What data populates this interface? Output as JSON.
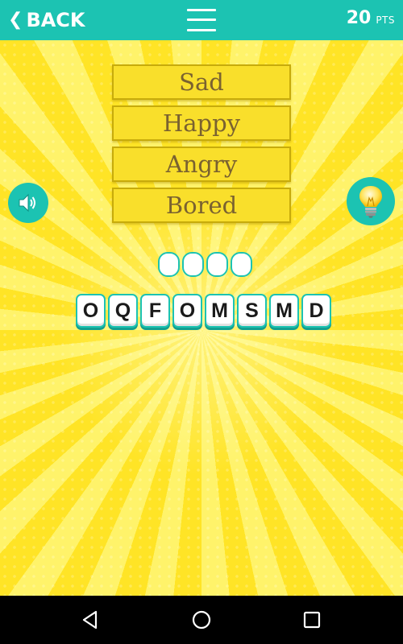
{
  "header": {
    "back_label": "BACK",
    "points_value": "20",
    "points_unit": "PTS"
  },
  "clues": [
    "Sad",
    "Happy",
    "Angry",
    "Bored"
  ],
  "answer": {
    "length": 4
  },
  "letter_tiles": [
    "O",
    "Q",
    "F",
    "O",
    "M",
    "S",
    "M",
    "D"
  ],
  "icons": {
    "back": "chevron-left-icon",
    "menu": "hamburger-menu-icon",
    "sound": "speaker-icon",
    "hint": "lightbulb-icon",
    "nav_back": "triangle-back-icon",
    "nav_home": "circle-home-icon",
    "nav_recent": "square-recents-icon"
  },
  "colors": {
    "accent": "#1cc3b2",
    "background": "#ffe426",
    "clue_box": "#f9df2b",
    "clue_text": "#7a6230"
  }
}
